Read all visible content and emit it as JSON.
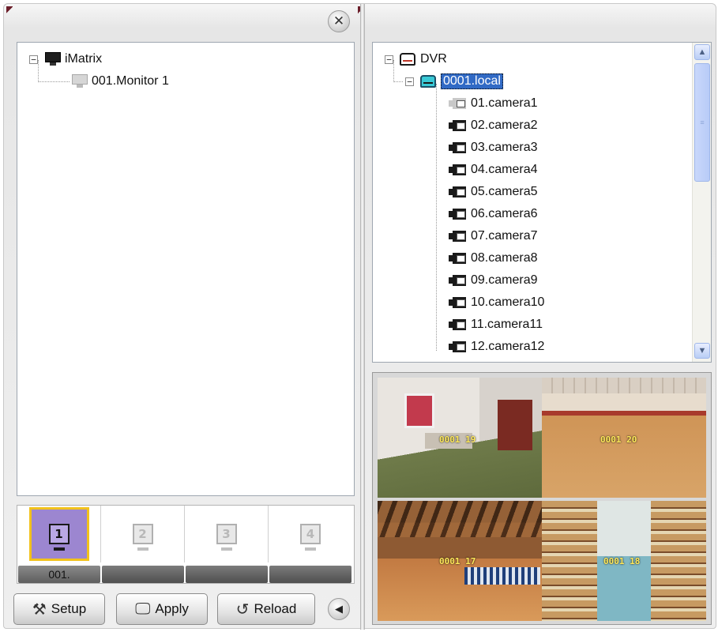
{
  "left_panel": {
    "tree": {
      "root_label": "iMatrix",
      "root_expander": "−",
      "child_label": "001.Monitor 1"
    },
    "monitor_tiles": [
      {
        "number": "1",
        "label": "001.",
        "active": true
      },
      {
        "number": "2",
        "label": "",
        "active": false
      },
      {
        "number": "3",
        "label": "",
        "active": false
      },
      {
        "number": "4",
        "label": "",
        "active": false
      }
    ],
    "buttons": {
      "setup": "Setup",
      "apply": "Apply",
      "reload": "Reload"
    },
    "close_glyph": "✕",
    "collapse_glyph": "◀"
  },
  "right_panel": {
    "tree": {
      "root_label": "DVR",
      "root_expander": "−",
      "dvr_label": "0001.local",
      "dvr_expander": "−",
      "cameras": [
        "01.camera1",
        "02.camera2",
        "03.camera3",
        "04.camera4",
        "05.camera5",
        "06.camera6",
        "07.camera7",
        "08.camera8",
        "09.camera9",
        "10.camera10",
        "11.camera11",
        "12.camera12"
      ]
    },
    "video_labels": [
      "0001 19",
      "0001 20",
      "0001 17",
      "0001 18"
    ],
    "scrollbar": {
      "up": "▲",
      "down": "▼",
      "grip": "≡"
    }
  },
  "colors": {
    "selection": "#316ac5",
    "active_tile": "#9c86d0",
    "active_tile_border": "#f2c21c"
  },
  "icons": {
    "close": "close-icon",
    "monitor": "monitor-icon",
    "dvr": "dvr-icon",
    "camera": "camera-icon",
    "setup": "tools-icon",
    "apply": "monitor-check-icon",
    "reload": "reload-icon",
    "collapse": "chevron-left-icon"
  }
}
